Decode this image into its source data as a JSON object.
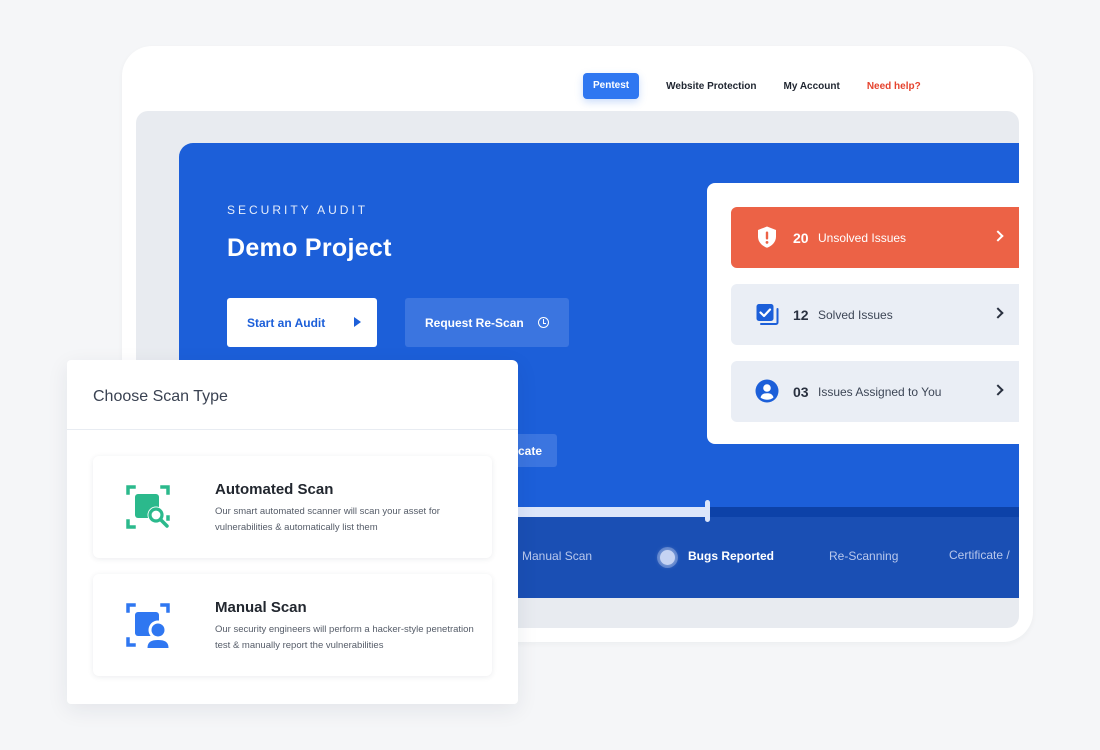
{
  "nav": {
    "items": [
      {
        "label": "Pentest",
        "active": true
      },
      {
        "label": "Website Protection",
        "active": false
      },
      {
        "label": "My Account",
        "active": false
      },
      {
        "label": "Need help?",
        "active": false
      }
    ]
  },
  "hero": {
    "eyebrow": "SECURITY AUDIT",
    "title": "Demo Project",
    "start_button": "Start an Audit",
    "rescan_button": "Request Re-Scan",
    "certificate_button_partial": "cate"
  },
  "issues": [
    {
      "count": "20",
      "label": "Unsolved Issues",
      "icon": "shield-alert-icon",
      "status": "danger"
    },
    {
      "count": "12",
      "label": "Solved Issues",
      "icon": "checkbox-stack-icon",
      "status": "normal"
    },
    {
      "count": "03",
      "label": "Issues Assigned to You",
      "icon": "user-circle-icon",
      "status": "normal"
    }
  ],
  "progress": {
    "fraction": 0.63,
    "steps": [
      {
        "label": "Manual Scan",
        "active": false
      },
      {
        "label": "Bugs Reported",
        "active": true
      },
      {
        "label": "Re-Scanning",
        "active": false
      },
      {
        "label": "Certificate /",
        "active": false
      }
    ]
  },
  "popup": {
    "title": "Choose Scan Type",
    "options": [
      {
        "title": "Automated Scan",
        "description": "Our smart automated scanner will scan your asset for vulnerabilities & automatically list them",
        "icon": "automated-scan-icon",
        "color": "#2bb98c"
      },
      {
        "title": "Manual Scan",
        "description": "Our security engineers will perform a hacker-style penetration test & manually report the vulnerabilities",
        "icon": "manual-scan-icon",
        "color": "#2f77f1"
      }
    ]
  },
  "colors": {
    "primary": "#1c5fd9",
    "nav_active": "#2f77f1",
    "danger": "#ec6246",
    "help": "#e5432e",
    "automated": "#2bb98c"
  }
}
